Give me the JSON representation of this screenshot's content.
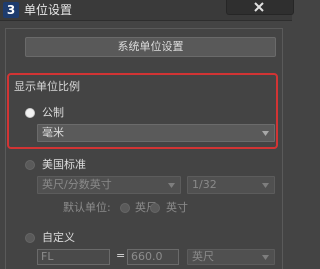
{
  "window": {
    "title": "单位设置",
    "app_icon_text": "3"
  },
  "system_units_button": "系统单位设置",
  "display_unit_scale": {
    "label": "显示单位比例",
    "metric": {
      "label": "公制",
      "selected": true,
      "dropdown_value": "毫米"
    },
    "us_standard": {
      "label": "美国标准",
      "selected": false,
      "dropdown_value": "英尺/分数英寸",
      "fraction_value": "1/32",
      "default_unit_label": "默认单位:",
      "option_feet": "英尺",
      "option_inches": "英寸"
    },
    "custom": {
      "label": "自定义",
      "selected": false,
      "name_value": "FL",
      "equals": "=",
      "amount_value": "660.0",
      "unit_value": "英尺"
    }
  },
  "colors": {
    "highlight_border": "#d23434",
    "background": "#444444"
  }
}
